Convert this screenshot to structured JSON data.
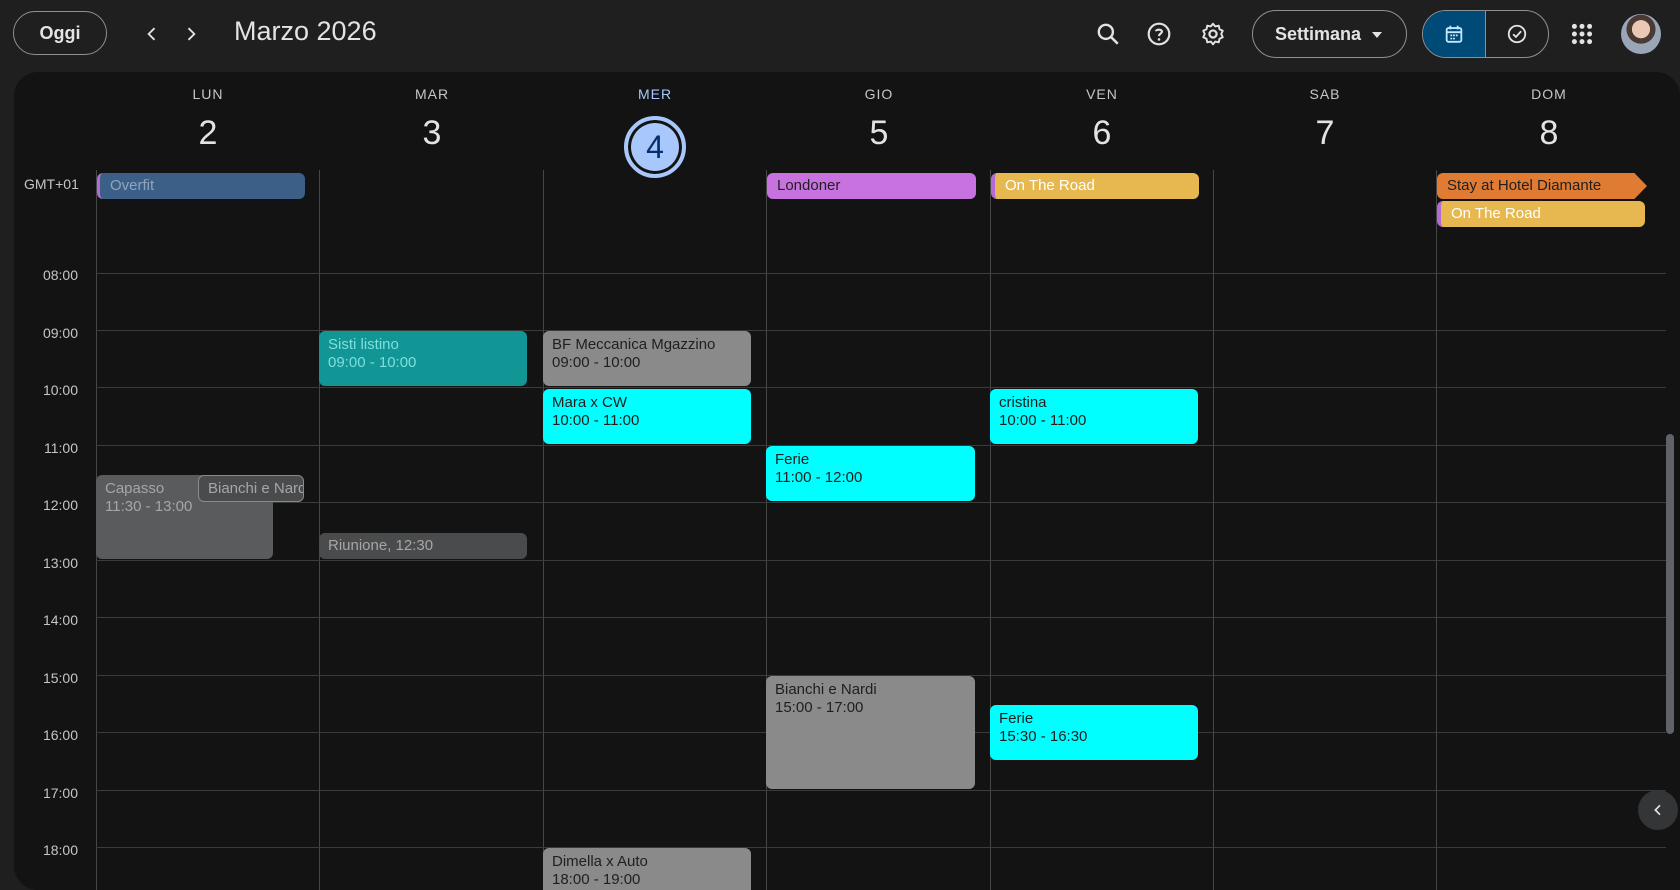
{
  "header": {
    "today_label": "Oggi",
    "month_title": "Marzo 2026",
    "view_label": "Settimana",
    "icons": [
      "chevron-left-icon",
      "chevron-right-icon",
      "search-icon",
      "help-icon",
      "settings-icon",
      "calendar-icon",
      "tasks-check-icon",
      "apps-grid-icon"
    ]
  },
  "timezone": "GMT+01",
  "days": [
    {
      "name": "LUN",
      "date": "2"
    },
    {
      "name": "MAR",
      "date": "3"
    },
    {
      "name": "MER",
      "date": "4"
    },
    {
      "name": "GIO",
      "date": "5"
    },
    {
      "name": "VEN",
      "date": "6"
    },
    {
      "name": "SAB",
      "date": "7"
    },
    {
      "name": "DOM",
      "date": "8"
    }
  ],
  "hours": [
    "08:00",
    "09:00",
    "10:00",
    "11:00",
    "12:00",
    "13:00",
    "14:00",
    "15:00",
    "16:00",
    "17:00",
    "18:00"
  ],
  "allday_events": [
    {
      "title": "Overfit",
      "color": "#3b5f86"
    },
    {
      "title": "Londoner",
      "color": "#c872e0"
    },
    {
      "title": "On The Road",
      "color": "#e6b84f"
    },
    {
      "title": "Stay at Hotel Diamante",
      "color": "#e07b33"
    },
    {
      "title": "On The Road",
      "color": "#e6b84f"
    }
  ],
  "events": [
    {
      "title": "Sisti listino",
      "time": "09:00 - 10:00",
      "color": "#129595"
    },
    {
      "title": "BF Meccanica Mgazzino",
      "time": "09:00 - 10:00",
      "color": "#8a8a8a"
    },
    {
      "title": "Mara x CW",
      "time": "10:00 - 11:00",
      "color": "#00ffff"
    },
    {
      "title": "cristina",
      "time": "10:00 - 11:00",
      "color": "#00ffff"
    },
    {
      "title": "Ferie",
      "time": "11:00 - 12:00",
      "color": "#00ffff"
    },
    {
      "title": "Capasso",
      "time": "11:30 - 13:00",
      "color": "#5a5b5c"
    },
    {
      "title": "Bianchi e Nardi",
      "time": "",
      "color": "#4a4b4c"
    },
    {
      "title": "Riunione, 12:30",
      "time": "",
      "color": "#4a4b4c"
    },
    {
      "title": "Bianchi e Nardi",
      "time": "15:00 - 17:00",
      "color": "#8a8a8a"
    },
    {
      "title": "Ferie",
      "time": "15:30 - 16:30",
      "color": "#00ffff"
    },
    {
      "title": "Dimella x Auto",
      "time": "18:00 - 19:00",
      "color": "#8a8a8a"
    }
  ]
}
